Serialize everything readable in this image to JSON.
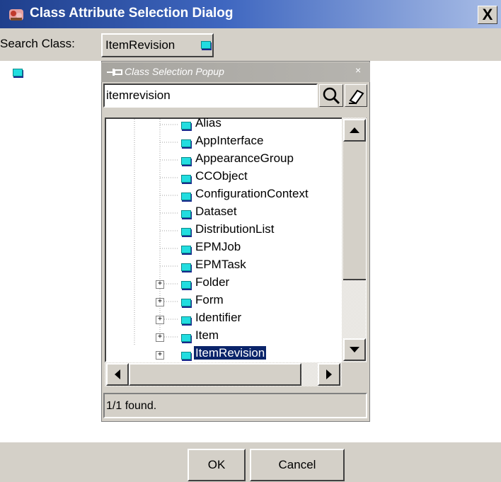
{
  "window": {
    "title": "Class Attribute Selection Dialog",
    "close_glyph": "X"
  },
  "search": {
    "label": "Search Class:",
    "selected_class": "ItemRevision"
  },
  "popup": {
    "title": "Class Selection Popup",
    "close_glyph": "×",
    "search_value": "itemrevision",
    "status": "1/1 found."
  },
  "tree": {
    "items": [
      {
        "label": "Alias",
        "expandable": false
      },
      {
        "label": "AppInterface",
        "expandable": false
      },
      {
        "label": "AppearanceGroup",
        "expandable": false
      },
      {
        "label": "CCObject",
        "expandable": false
      },
      {
        "label": "ConfigurationContext",
        "expandable": false
      },
      {
        "label": "Dataset",
        "expandable": false
      },
      {
        "label": "DistributionList",
        "expandable": false
      },
      {
        "label": "EPMJob",
        "expandable": false
      },
      {
        "label": "EPMTask",
        "expandable": false
      },
      {
        "label": "Folder",
        "expandable": true
      },
      {
        "label": "Form",
        "expandable": true
      },
      {
        "label": "Identifier",
        "expandable": true
      },
      {
        "label": "Item",
        "expandable": true
      },
      {
        "label": "ItemRevision",
        "expandable": true,
        "selected": true
      }
    ]
  },
  "buttons": {
    "ok": "OK",
    "cancel": "Cancel"
  },
  "colors": {
    "title_bar": "#1f3f8c",
    "selection": "#0a246a",
    "class_cube": "#22dde0",
    "dialog_bg": "#d4d0c8"
  }
}
